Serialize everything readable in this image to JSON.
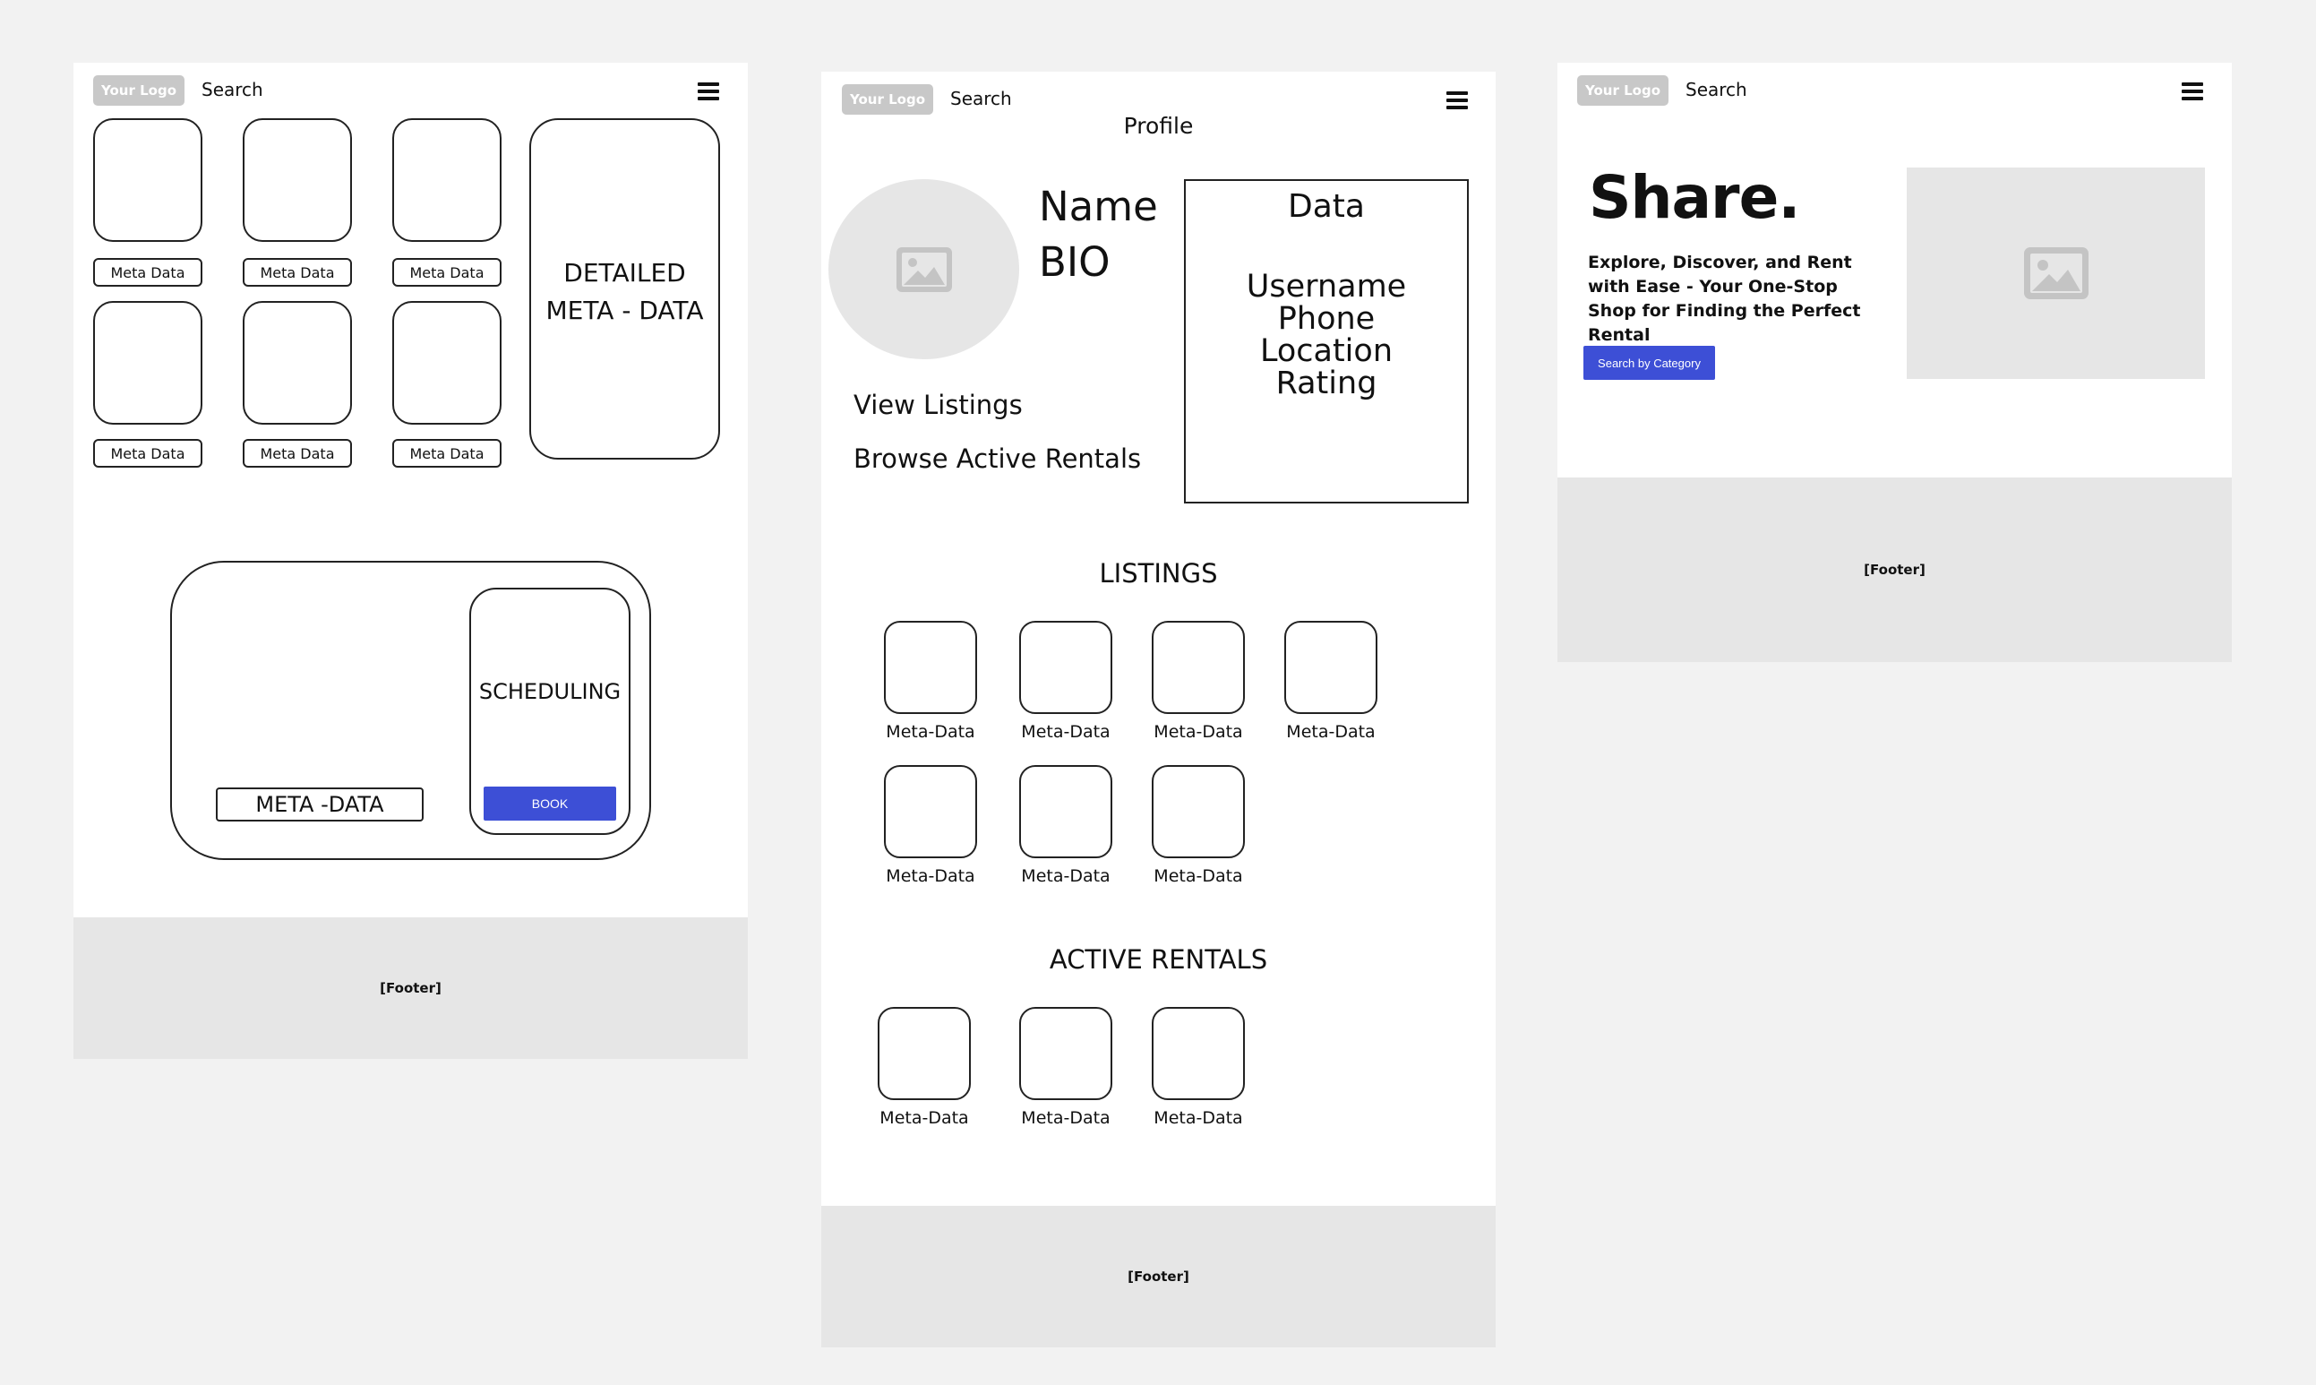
{
  "nav": {
    "logo": "Your Logo",
    "search": "Search"
  },
  "frame1": {
    "meta_labels": [
      "Meta Data",
      "Meta Data",
      "Meta Data",
      "Meta Data",
      "Meta Data",
      "Meta Data"
    ],
    "detailed_line1": "DETAILED",
    "detailed_line2": "META - DATA",
    "scheduling": "SCHEDULING",
    "book": "BOOK",
    "meta_data": "META -DATA",
    "footer": "[Footer]"
  },
  "frame2": {
    "profile_title": "Profile",
    "name": "Name",
    "bio": "BIO",
    "data_title": "Data",
    "data_fields": [
      "Username",
      "Phone",
      "Location",
      "Rating"
    ],
    "view_listings": "View Listings",
    "browse_rentals": "Browse Active Rentals",
    "listings_heading": "LISTINGS",
    "listing_labels": [
      "Meta-Data",
      "Meta-Data",
      "Meta-Data",
      "Meta-Data",
      "Meta-Data",
      "Meta-Data",
      "Meta-Data"
    ],
    "rentals_heading": "ACTIVE RENTALS",
    "rental_labels": [
      "Meta-Data",
      "Meta-Data",
      "Meta-Data"
    ],
    "footer": "[Footer]"
  },
  "frame3": {
    "headline": "Share.",
    "subtext": "Explore, Discover, and Rent with Ease - Your One-Stop Shop for Finding the Perfect Rental",
    "cta": "Search by Category",
    "footer": "[Footer]"
  },
  "colors": {
    "accent": "#3d4fd6",
    "footer_bg": "#e6e6e6",
    "page_bg": "#f2f2f2",
    "logo_bg": "#c8c8c8"
  }
}
